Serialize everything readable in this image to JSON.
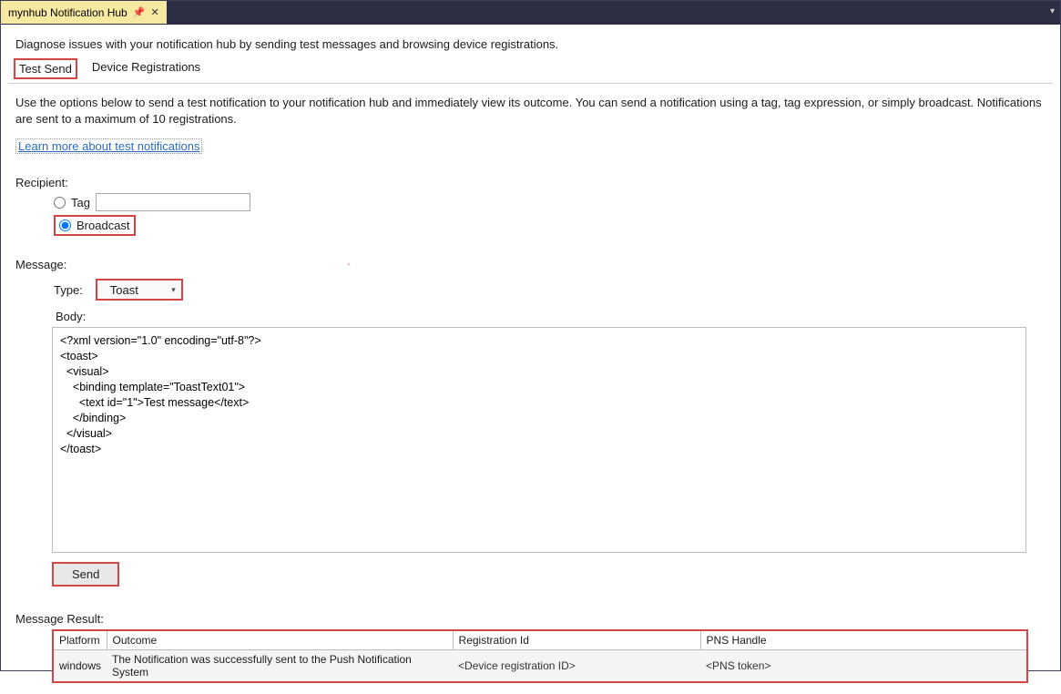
{
  "titlebar": {
    "tab_title": "mynhub Notification Hub"
  },
  "header": {
    "tagline": "Diagnose issues with your notification hub by sending test messages and browsing device registrations."
  },
  "subtabs": {
    "test_send": "Test Send",
    "device_registrations": "Device Registrations"
  },
  "intro": {
    "text": "Use the options below to send a test notification to your notification hub and immediately view its outcome. You can send a notification using a tag, tag expression, or simply broadcast. Notifications are sent to a maximum of 10 registrations.",
    "learn_more": "Learn more about test notifications"
  },
  "recipient": {
    "label": "Recipient:",
    "tag_label": "Tag",
    "tag_value": "",
    "broadcast_label": "Broadcast"
  },
  "message": {
    "label": "Message:",
    "type_label": "Type:",
    "type_value": "Toast",
    "body_label": "Body:",
    "body_value": "<?xml version=\"1.0\" encoding=\"utf-8\"?>\n<toast>\n  <visual>\n    <binding template=\"ToastText01\">\n      <text id=\"1\">Test message</text>\n    </binding>\n  </visual>\n</toast>",
    "send_label": "Send"
  },
  "result": {
    "label": "Message Result:",
    "columns": {
      "platform": "Platform",
      "outcome": "Outcome",
      "registration_id": "Registration Id",
      "pns_handle": "PNS Handle"
    },
    "rows": [
      {
        "platform": "windows",
        "outcome": "The Notification was successfully sent to the Push Notification System",
        "registration_id": "<Device registration ID>",
        "pns_handle": "<PNS token>"
      }
    ]
  }
}
